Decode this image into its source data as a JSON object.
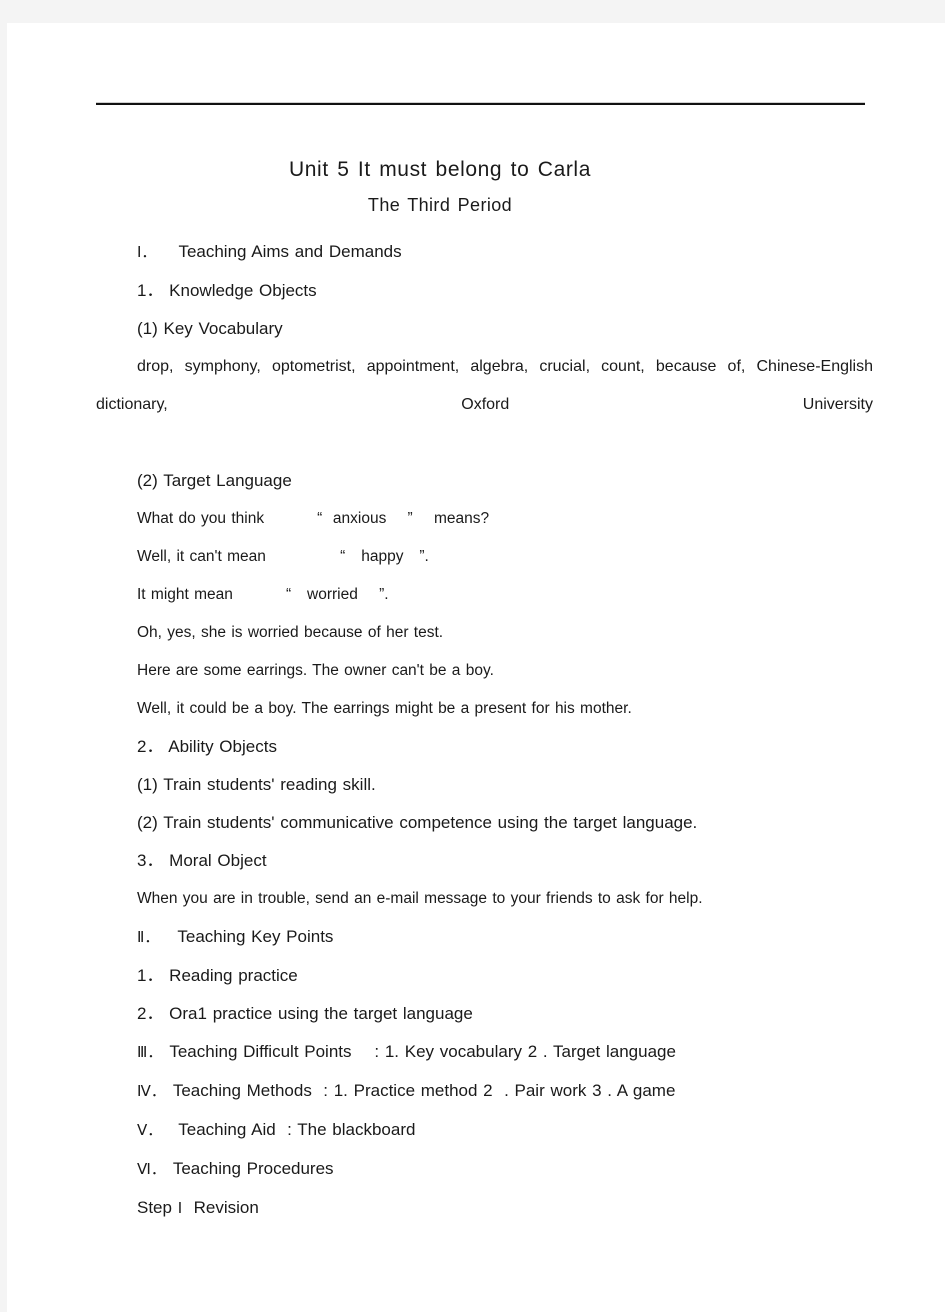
{
  "document": {
    "title": "Unit 5 It must belong to Carla",
    "subtitle": "The Third Period",
    "sections": {
      "aims_heading_numeral": "Ⅰ．",
      "aims_heading_text": "Teaching Aims and Demands",
      "knowledge_objects": "1． Knowledge Objects",
      "key_vocabulary_label": "(1) Key Vocabulary",
      "key_vocabulary_list": "drop, symphony, optometrist, appointment, algebra, crucial, count, because of, Chinese-English dictionary, Oxford University",
      "target_language_label": "(2) Target Language",
      "target_language_lines": [
        "What do you think          “  anxious    ”    means?",
        "Well, it can't mean              “   happy   ”.",
        "It might mean          “   worried    ”.",
        "Oh, yes, she is worried because of her test.",
        "Here are some earrings. The owner can't be a boy.",
        "Well, it could be a boy. The earrings might be a present for his mother."
      ],
      "ability_objects": "2． Ability Objects",
      "ability_object_1": "(1) Train students' reading skill.",
      "ability_object_2": "(2) Train students' communicative competence using the target language.",
      "moral_object": "3． Moral Object",
      "moral_object_text": "When you are in trouble, send an e-mail message to your friends to ask for help.",
      "key_points_numeral": "Ⅱ．",
      "key_points_text": "Teaching Key Points",
      "key_point_1": "1． Reading practice",
      "key_point_2": "2． Ora1 practice using the target language",
      "difficult_points_numeral": "Ⅲ．",
      "difficult_points_text": "Teaching Difficult Points    : 1. Key vocabulary 2 . Target language",
      "methods_numeral": "Ⅳ．",
      "methods_text": "Teaching Methods  : 1. Practice method 2  . Pair work 3 . A game",
      "aid_numeral": "Ⅴ．",
      "aid_text": "Teaching Aid  : The blackboard",
      "procedures_numeral": "Ⅵ．",
      "procedures_text": "Teaching Procedures",
      "step_one_prefix": "Step ",
      "step_one_numeral": "Ⅰ",
      "step_one_text": "  Revision"
    }
  }
}
